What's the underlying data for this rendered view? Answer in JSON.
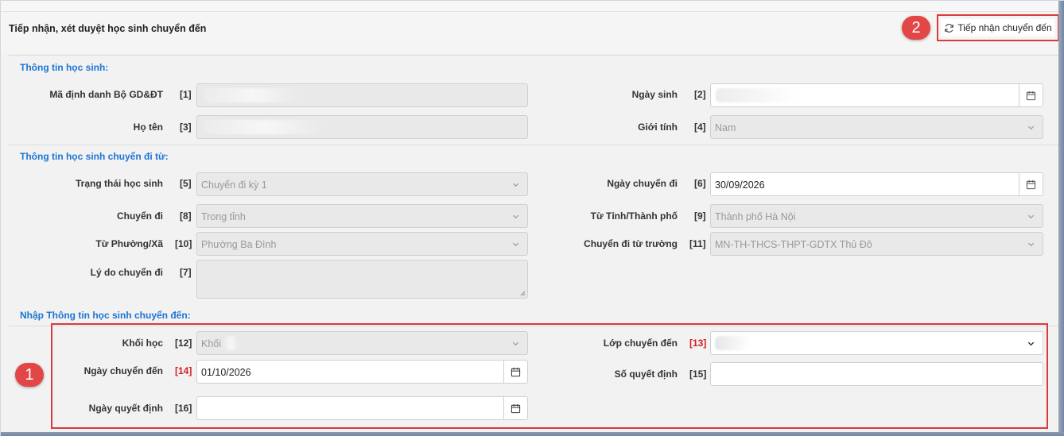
{
  "header": {
    "title": "Tiếp nhận, xét duyệt học sinh chuyển đến",
    "accept_button": "Tiếp nhận chuyển đến"
  },
  "badges": {
    "one": "1",
    "two": "2"
  },
  "sections": {
    "student": "Thông tin học sinh:",
    "from": "Thông tin học sinh chuyển đi từ:",
    "to": "Nhập Thông tin học sinh chuyển đến:"
  },
  "fields": {
    "ma_dinh_danh": {
      "label": "Mã định danh Bộ GD&ĐT",
      "num": "[1]",
      "value": ""
    },
    "ngay_sinh": {
      "label": "Ngày sinh",
      "num": "[2]",
      "value": ""
    },
    "ho_ten": {
      "label": "Họ tên",
      "num": "[3]",
      "value": ""
    },
    "gioi_tinh": {
      "label": "Giới tính",
      "num": "[4]",
      "value": "Nam"
    },
    "trang_thai": {
      "label": "Trạng thái học sinh",
      "num": "[5]",
      "value": "Chuyển đi kỳ 1"
    },
    "ngay_chuyen_di": {
      "label": "Ngày chuyển đi",
      "num": "[6]",
      "value": "30/09/2026"
    },
    "ly_do": {
      "label": "Lý do chuyển đi",
      "num": "[7]",
      "value": ""
    },
    "chuyen_di": {
      "label": "Chuyển đi",
      "num": "[8]",
      "value": "Trong tỉnh"
    },
    "tu_tinh": {
      "label": "Từ Tỉnh/Thành phố",
      "num": "[9]",
      "value": "Thành phố Hà Nội"
    },
    "tu_phuong": {
      "label": "Từ Phường/Xã",
      "num": "[10]",
      "value": "Phường Ba Đình"
    },
    "tu_truong": {
      "label": "Chuyển đi từ trường",
      "num": "[11]",
      "value": "MN-TH-THCS-THPT-GDTX Thủ Đô"
    },
    "khoi_hoc": {
      "label": "Khối học",
      "num": "[12]",
      "value": "Khối"
    },
    "lop_chuyen_den": {
      "label": "Lớp chuyển đến",
      "num": "[13]",
      "value": ""
    },
    "ngay_chuyen_den": {
      "label": "Ngày chuyển đến",
      "num": "[14]",
      "value": "01/10/2026"
    },
    "so_quyet_dinh": {
      "label": "Số quyết định",
      "num": "[15]",
      "value": ""
    },
    "ngay_quyet_dinh": {
      "label": "Ngày quyết định",
      "num": "[16]",
      "value": ""
    }
  },
  "colors": {
    "accent": "#1c74d4",
    "required": "#d31f1f",
    "highlight": "#d93a3a"
  }
}
